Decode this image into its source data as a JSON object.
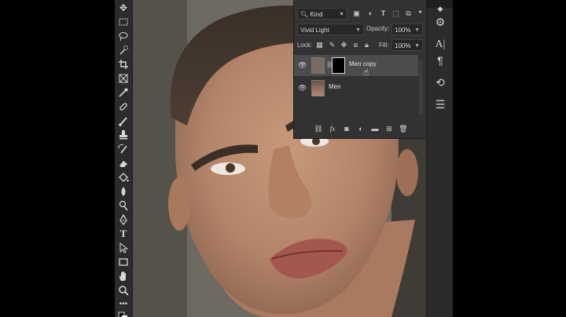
{
  "filter": {
    "kind_label": "Kind"
  },
  "blend": {
    "mode": "Vivid Light",
    "opacity_label": "Opacity:",
    "opacity_value": "100%"
  },
  "lock": {
    "label": "Lock:",
    "fill_label": "Fill:",
    "fill_value": "100%"
  },
  "layers": [
    {
      "name": "Men copy",
      "selected": true
    },
    {
      "name": "Men",
      "selected": false
    }
  ],
  "colors": {
    "panel": "#323232",
    "selected_row": "#4c4c4c",
    "toolbar": "#2b2b2b"
  },
  "icons": {
    "toolbar": [
      "move-icon",
      "marquee-icon",
      "lasso-icon",
      "quick-select-icon",
      "crop-icon",
      "frame-icon",
      "eyedropper-icon",
      "healing-brush-icon",
      "brush-icon",
      "clone-stamp-icon",
      "history-brush-icon",
      "eraser-icon",
      "paint-bucket-icon",
      "blur-icon",
      "dodge-icon",
      "pen-icon",
      "type-icon",
      "path-select-icon",
      "rectangle-icon",
      "hand-icon",
      "zoom-icon",
      "more-tools-icon"
    ],
    "right": [
      "character-icon",
      "paragraph-icon",
      "history-icon",
      "adjustments-icon"
    ]
  }
}
